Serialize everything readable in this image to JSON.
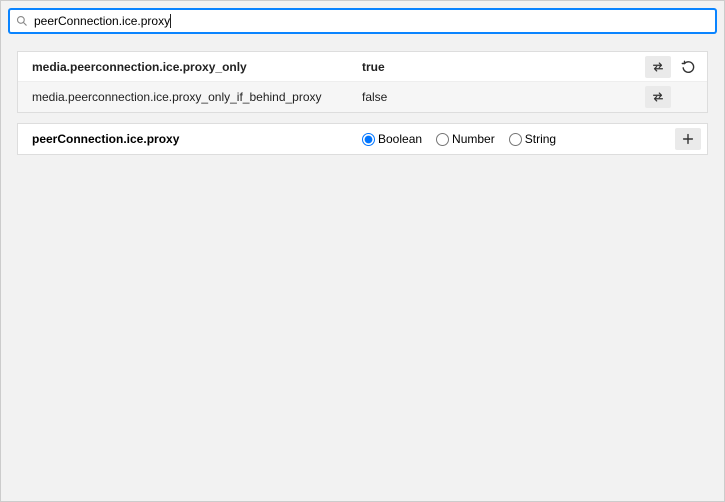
{
  "search": {
    "value": "peerConnection.ice.proxy",
    "placeholder": ""
  },
  "prefs": [
    {
      "name": "media.peerconnection.ice.proxy_only",
      "value": "true",
      "modified": true,
      "hasReset": true
    },
    {
      "name": "media.peerconnection.ice.proxy_only_if_behind_proxy",
      "value": "false",
      "modified": false,
      "hasReset": false
    }
  ],
  "newPref": {
    "name": "peerConnection.ice.proxy",
    "types": [
      "Boolean",
      "Number",
      "String"
    ],
    "selected": "Boolean"
  }
}
